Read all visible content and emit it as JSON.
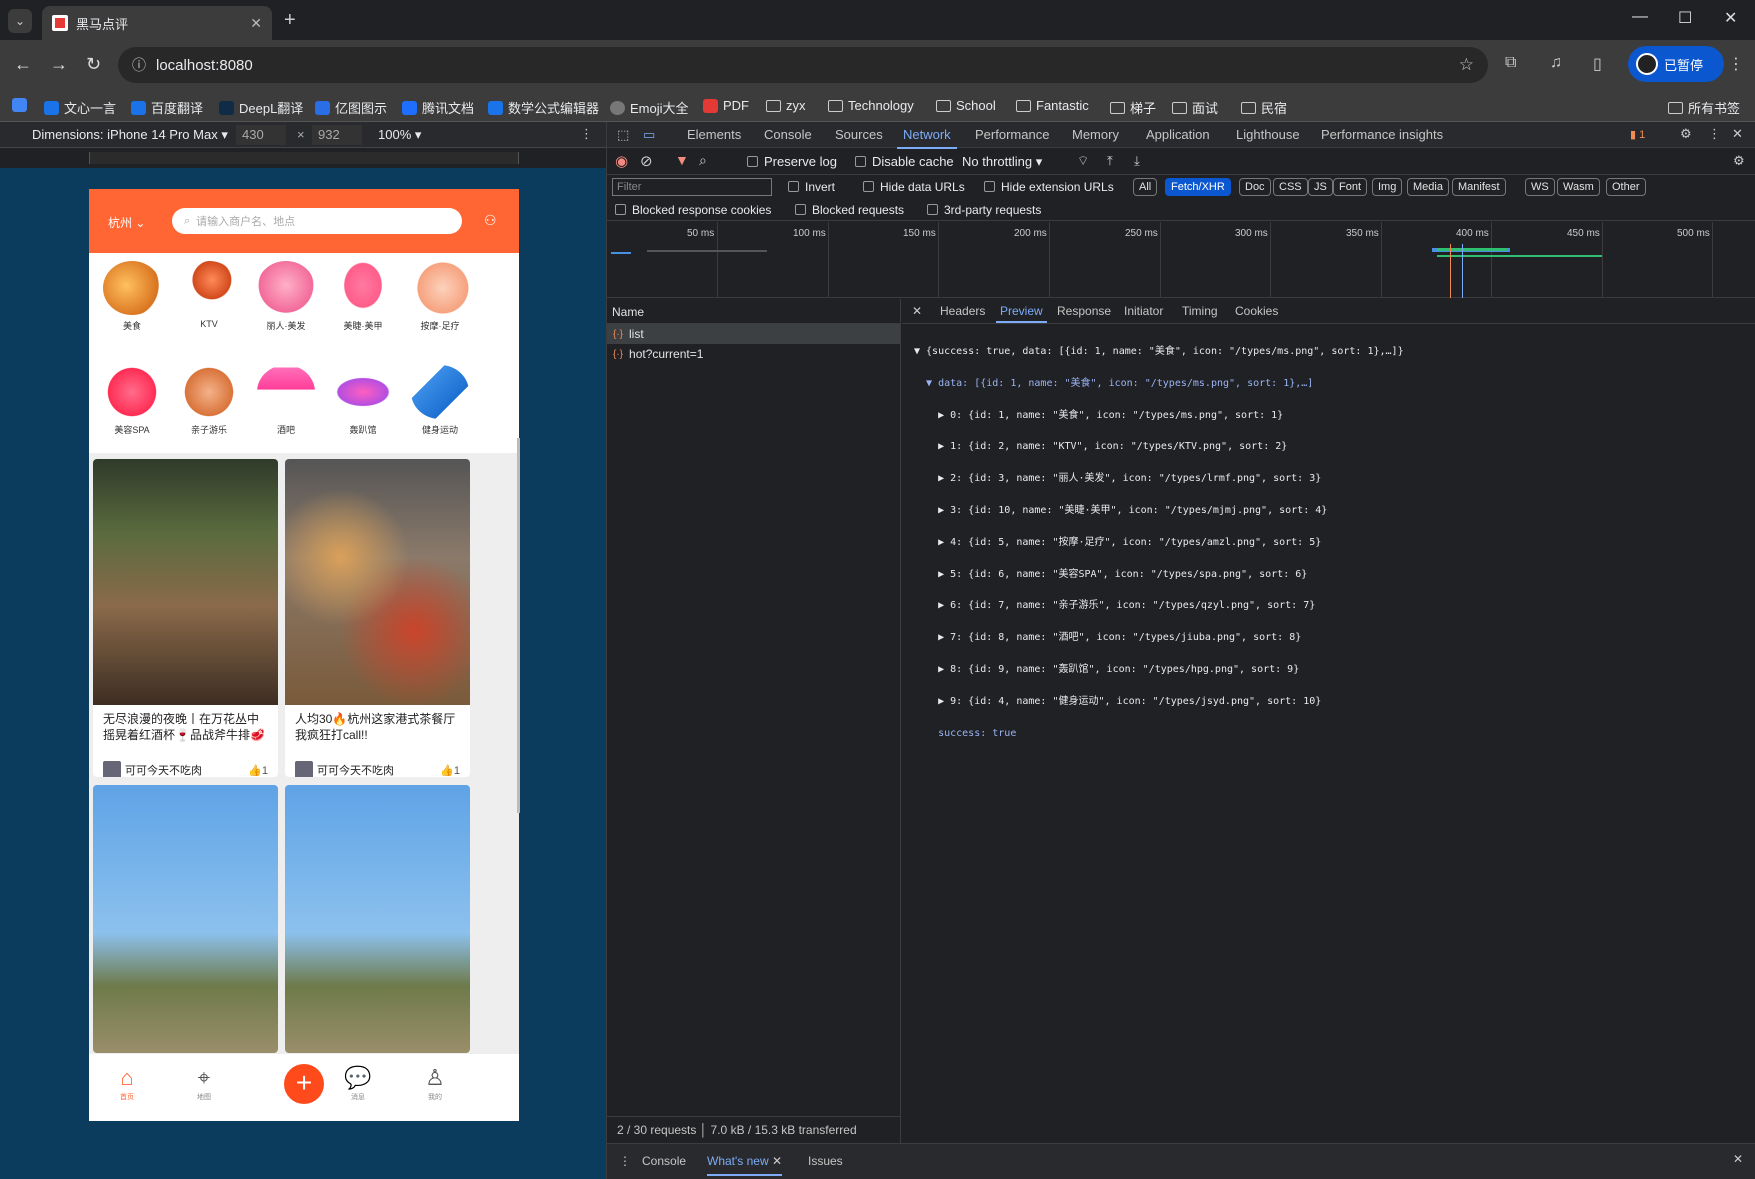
{
  "browser": {
    "tab_title": "黑马点评",
    "url": "localhost:8080",
    "profile_label": "已暂停"
  },
  "bookmarks": [
    {
      "label": "文心一言",
      "color": "#1a73e8"
    },
    {
      "label": "百度翻译",
      "color": "#1a73e8"
    },
    {
      "label": "DeepL翻译",
      "color": "#0f2b46"
    },
    {
      "label": "亿图图示",
      "color": "#2b6de5"
    },
    {
      "label": "腾讯文档",
      "color": "#1e6fff"
    },
    {
      "label": "数学公式编辑器",
      "color": "#1a73e8"
    },
    {
      "label": "Emoji大全",
      "color": "#666"
    },
    {
      "label": "PDF",
      "color": "#e53935"
    },
    {
      "label": "zyx",
      "folder": true
    },
    {
      "label": "Technology",
      "folder": true
    },
    {
      "label": "School",
      "folder": true
    },
    {
      "label": "Fantastic",
      "folder": true
    },
    {
      "label": "梯子",
      "folder": true
    },
    {
      "label": "面试",
      "folder": true
    },
    {
      "label": "民宿",
      "folder": true
    }
  ],
  "bookmarks_all": "所有书签",
  "devbar": {
    "dimensions": "Dimensions: iPhone 14 Pro Max",
    "width": "430",
    "x": "×",
    "height": "932",
    "zoom": "100%"
  },
  "app": {
    "city": "杭州",
    "search_placeholder": "请输入商户名、地点",
    "categories": [
      {
        "label": "美食",
        "color": "#f39a3b"
      },
      {
        "label": "KTV",
        "color": "#e8562f"
      },
      {
        "label": "丽人·美发",
        "color": "#f26a9a"
      },
      {
        "label": "美睫·美甲",
        "color": "#ff5d8a"
      },
      {
        "label": "按摩·足疗",
        "color": "#f6b79a"
      },
      {
        "label": "美容SPA",
        "color": "#ff4d6d"
      },
      {
        "label": "亲子游乐",
        "color": "#e0895a"
      },
      {
        "label": "酒吧",
        "color": "#ff5fb3"
      },
      {
        "label": "轰趴馆",
        "color": "#c36bd9"
      },
      {
        "label": "健身运动",
        "color": "#3a8ee6"
      }
    ],
    "cards": [
      {
        "title": "无尽浪漫的夜晚丨在万花丛中摇晃着红酒杯🍷品战斧牛排🥩",
        "author": "可可今天不吃肉",
        "likes": "1"
      },
      {
        "title": "人均30🔥杭州这家港式茶餐厅我疯狂打call!!",
        "author": "可可今天不吃肉",
        "likes": "1"
      },
      {
        "title": "",
        "author": "",
        "likes": ""
      },
      {
        "title": "",
        "author": "",
        "likes": ""
      }
    ],
    "nav": [
      {
        "label": "首页",
        "icon": "home-icon"
      },
      {
        "label": "地图",
        "icon": "map-pin-icon"
      },
      {
        "label": "+",
        "icon": "plus-icon"
      },
      {
        "label": "消息",
        "icon": "chat-icon"
      },
      {
        "label": "我的",
        "icon": "user-icon"
      }
    ]
  },
  "devtools": {
    "tabs": [
      "Elements",
      "Console",
      "Sources",
      "Network",
      "Performance",
      "Memory",
      "Application",
      "Lighthouse",
      "Performance insights"
    ],
    "active_tab": "Network",
    "issues_count": "1",
    "preserve_log": "Preserve log",
    "disable_cache": "Disable cache",
    "throttling": "No throttling",
    "filter_placeholder": "Filter",
    "invert": "Invert",
    "hide_data_urls": "Hide data URLs",
    "hide_ext_urls": "Hide extension URLs",
    "type_filters": [
      "All",
      "Fetch/XHR",
      "Doc",
      "CSS",
      "JS",
      "Font",
      "Img",
      "Media",
      "Manifest",
      "WS",
      "Wasm",
      "Other"
    ],
    "active_filter": "Fetch/XHR",
    "blocked_cookies": "Blocked response cookies",
    "blocked_requests": "Blocked requests",
    "third_party": "3rd-party requests",
    "timeline_ticks": [
      "50 ms",
      "100 ms",
      "150 ms",
      "200 ms",
      "250 ms",
      "300 ms",
      "350 ms",
      "400 ms",
      "450 ms",
      "500 ms"
    ],
    "name_header": "Name",
    "requests": [
      "list",
      "hot?current=1"
    ],
    "detail_tabs": [
      "Headers",
      "Preview",
      "Response",
      "Initiator",
      "Timing",
      "Cookies"
    ],
    "active_detail": "Preview",
    "preview_lines": [
      "▼ {success: true, data: [{id: 1, name: \"美食\", icon: \"/types/ms.png\", sort: 1},…]}",
      "  ▼ data: [{id: 1, name: \"美食\", icon: \"/types/ms.png\", sort: 1},…]",
      "    ▶ 0: {id: 1, name: \"美食\", icon: \"/types/ms.png\", sort: 1}",
      "    ▶ 1: {id: 2, name: \"KTV\", icon: \"/types/KTV.png\", sort: 2}",
      "    ▶ 2: {id: 3, name: \"丽人·美发\", icon: \"/types/lrmf.png\", sort: 3}",
      "    ▶ 3: {id: 10, name: \"美睫·美甲\", icon: \"/types/mjmj.png\", sort: 4}",
      "    ▶ 4: {id: 5, name: \"按摩·足疗\", icon: \"/types/amzl.png\", sort: 5}",
      "    ▶ 5: {id: 6, name: \"美容SPA\", icon: \"/types/spa.png\", sort: 6}",
      "    ▶ 6: {id: 7, name: \"亲子游乐\", icon: \"/types/qzyl.png\", sort: 7}",
      "    ▶ 7: {id: 8, name: \"酒吧\", icon: \"/types/jiuba.png\", sort: 8}",
      "    ▶ 8: {id: 9, name: \"轰趴馆\", icon: \"/types/hpg.png\", sort: 9}",
      "    ▶ 9: {id: 4, name: \"健身运动\", icon: \"/types/jsyd.png\", sort: 10}",
      "    success: true"
    ],
    "status": "2 / 30 requests  │  7.0 kB / 15.3 kB transferred",
    "drawer_tabs": [
      "Console",
      "What's new",
      "Issues"
    ]
  }
}
